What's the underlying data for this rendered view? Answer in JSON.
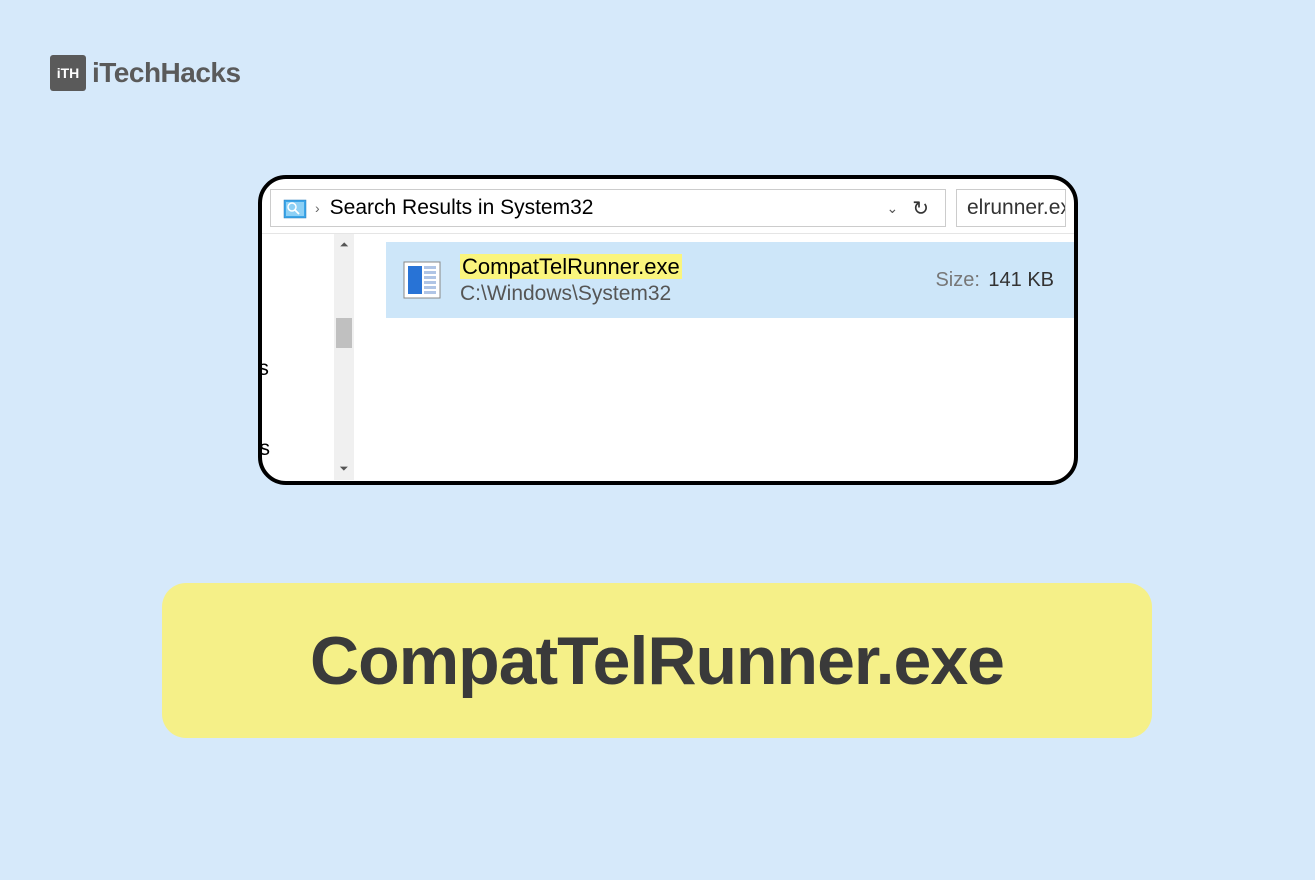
{
  "watermark": {
    "icon_text": "iTH",
    "label": "iTechHacks"
  },
  "explorer": {
    "breadcrumb": "Search Results in System32",
    "search_query": "elrunner.ex",
    "nav_items": [
      "cts",
      "nts"
    ],
    "result": {
      "filename": "CompatTelRunner.exe",
      "path": "C:\\Windows\\System32",
      "size_label": "Size:",
      "size_value": "141 KB"
    }
  },
  "banner": {
    "title": "CompatTelRunner.exe"
  }
}
